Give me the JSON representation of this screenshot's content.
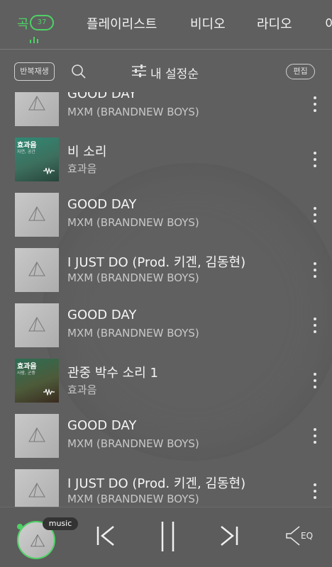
{
  "tabs": {
    "song": {
      "label": "곡",
      "count": "37"
    },
    "playlist": "플레이리스트",
    "video": "비디오",
    "radio": "라디오",
    "more": "이"
  },
  "toolbar": {
    "repeat_label": "반복재생",
    "sort_label": "내 설정순",
    "edit_label": "편집"
  },
  "songs": [
    {
      "title": "GOOD DAY",
      "artist": "MXM (BRANDNEW BOYS)",
      "art": "gray"
    },
    {
      "title": "비 소리",
      "artist": "효과음",
      "art": "sfx",
      "art_title": "효과음",
      "art_sub": "자연, 공간"
    },
    {
      "title": "GOOD DAY",
      "artist": "MXM (BRANDNEW BOYS)",
      "art": "gray"
    },
    {
      "title": "I JUST DO (Prod. 키겐, 김동현)",
      "artist": "MXM (BRANDNEW BOYS)",
      "art": "gray"
    },
    {
      "title": "GOOD DAY",
      "artist": "MXM (BRANDNEW BOYS)",
      "art": "gray"
    },
    {
      "title": "관중 박수 소리 1",
      "artist": "효과음",
      "art": "sfx2",
      "art_title": "효과음",
      "art_sub": "사람, 군중"
    },
    {
      "title": "GOOD DAY",
      "artist": "MXM (BRANDNEW BOYS)",
      "art": "gray"
    },
    {
      "title": "I JUST DO (Prod. 키겐, 김동현)",
      "artist": "MXM (BRANDNEW BOYS)",
      "art": "gray"
    }
  ],
  "player": {
    "tag": "music",
    "eq_label": "EQ",
    "accent_color": "#4ed165"
  }
}
